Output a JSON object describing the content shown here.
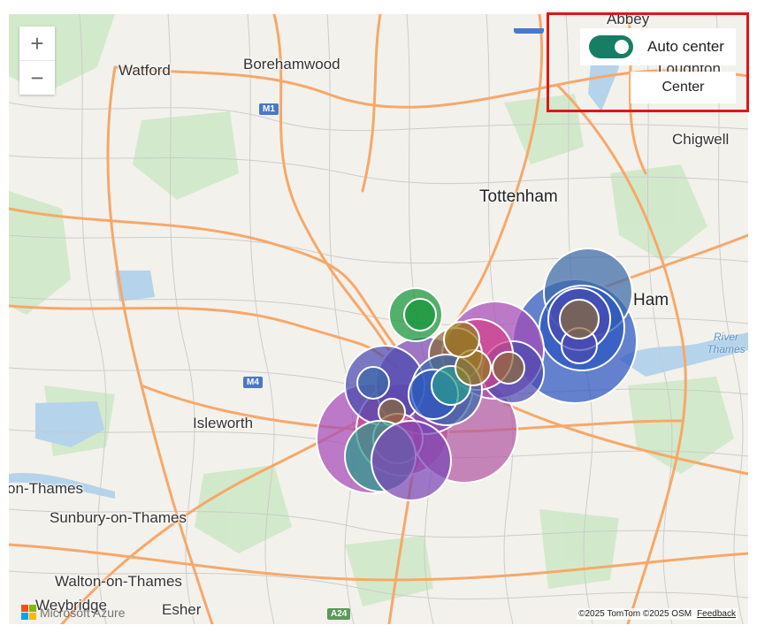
{
  "map": {
    "places": {
      "abbey": "Abbey",
      "loughton": "Loughton",
      "watford": "Watford",
      "borehamwood": "Borehamwood",
      "chigwell": "Chigwell",
      "tottenham": "Tottenham",
      "ham": "Ham",
      "river": "River Thames",
      "isleworth": "Isleworth",
      "on_thames": "on-Thames",
      "sunbury": "Sunbury-on-Thames",
      "walton": "Walton-on-Thames",
      "weybridge": "Weybridge",
      "esher": "Esher"
    },
    "shields": {
      "m1": "M1",
      "m4": "M4",
      "a24": "A24"
    },
    "bubble_colors": [
      "#4a4ab0",
      "#2b56c0",
      "#7b46b6",
      "#a64bb8",
      "#2a9a8c",
      "#d0408a",
      "#16963a",
      "#8a6a3a",
      "#b35aa2",
      "#3b6aa8",
      "#9a7a1e"
    ]
  },
  "controls": {
    "zoom_in": "+",
    "zoom_out": "−",
    "auto_center_label": "Auto center",
    "auto_center_on": true,
    "center_button": "Center"
  },
  "footer": {
    "logo_text": "Microsoft Azure",
    "attribution": "©2025 TomTom ©2025 OSM",
    "feedback": "Feedback"
  },
  "colors": {
    "toggle_on": "#177d64",
    "highlight_border": "#e01616"
  }
}
